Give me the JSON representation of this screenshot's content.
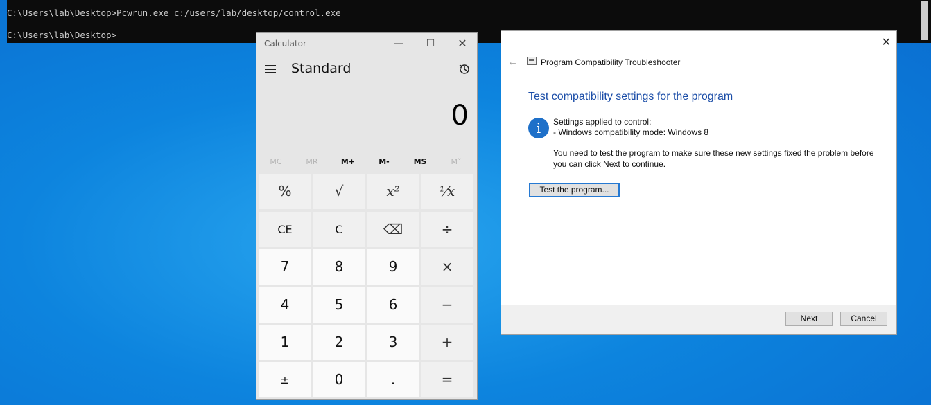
{
  "console": {
    "line1": "C:\\Users\\lab\\Desktop>Pcwrun.exe c:/users/lab/desktop/control.exe",
    "line2": "C:\\Users\\lab\\Desktop>"
  },
  "calculator": {
    "title": "Calculator",
    "mode": "Standard",
    "display": "0",
    "window_controls": {
      "minimize": "—",
      "maximize": "☐",
      "close": "✕"
    },
    "memory": [
      {
        "label": "MC",
        "enabled": false
      },
      {
        "label": "MR",
        "enabled": false
      },
      {
        "label": "M+",
        "enabled": true
      },
      {
        "label": "M-",
        "enabled": true
      },
      {
        "label": "MS",
        "enabled": true
      },
      {
        "label": "M˅",
        "enabled": false
      }
    ],
    "keys": [
      [
        "%",
        "√",
        "x²",
        "¹⁄x"
      ],
      [
        "CE",
        "C",
        "⌫",
        "÷"
      ],
      [
        "7",
        "8",
        "9",
        "×"
      ],
      [
        "4",
        "5",
        "6",
        "−"
      ],
      [
        "1",
        "2",
        "3",
        "+"
      ],
      [
        "±",
        "0",
        ".",
        "="
      ]
    ]
  },
  "troubleshooter": {
    "title": "Program Compatibility Troubleshooter",
    "heading": "Test compatibility settings for the program",
    "settings_line1": "Settings applied to control:",
    "settings_line2": "- Windows compatibility mode: Windows 8",
    "note_line1": "You need to test the program to make sure these new settings fixed the problem before",
    "note_line2": "you can click Next to continue.",
    "test_button": "Test the program...",
    "next_button": "Next",
    "cancel_button": "Cancel",
    "close": "✕",
    "back": "←",
    "info_glyph": "i"
  }
}
